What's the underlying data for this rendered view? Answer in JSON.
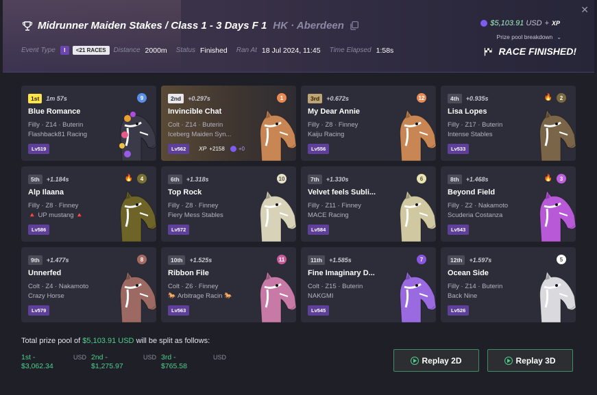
{
  "header": {
    "race_title": "Midrunner Maiden Stakes / Class 1 - 3 Days F 1",
    "location": "HK · Aberdeen",
    "prize_amount": "$5,103.91",
    "prize_unit": "USD",
    "prize_plus": "+",
    "prize_xp": "XP",
    "breakdown_label": "Prize pool breakdown",
    "status_banner": "RACE FINISHED!",
    "meta": {
      "event_type_label": "Event Type",
      "class_badge": "I",
      "races_badge": "<21 RACES",
      "distance_label": "Distance",
      "distance": "2000m",
      "status_label": "Status",
      "status": "Finished",
      "ran_at_label": "Ran At",
      "ran_at": "18 Jul 2024, 11:45",
      "elapsed_label": "Time Elapsed",
      "elapsed": "1:58s"
    }
  },
  "results": [
    {
      "place": "1st",
      "gap": "1m 57s",
      "number": "9",
      "num_color": "#5a8ee8",
      "fire": false,
      "name": "Blue Romance",
      "info": "Filly · Z14 · Buterin",
      "stable": "Flashback81 Racing",
      "level": "Lv519",
      "horse_color": "#3a3a48",
      "accent": "flowers"
    },
    {
      "place": "2nd",
      "gap": "+0.297s",
      "number": "1",
      "num_color": "#e88a55",
      "fire": false,
      "name": "Invincible Chat",
      "info": "Colt · Z14 · Buterin",
      "stable": "Iceberg Maiden Syn...",
      "level": "Lv562",
      "xp_label": "XP",
      "xp_value": "+2158",
      "xp_zero": "+0",
      "horse_color": "#c88654"
    },
    {
      "place": "3rd",
      "gap": "+0.672s",
      "number": "12",
      "num_color": "#e88a55",
      "fire": false,
      "name": "My Dear Annie",
      "info": "Filly · Z8 · Finney",
      "stable": "Kaiju Racing",
      "level": "Lv556",
      "horse_color": "#c88654"
    },
    {
      "place": "4th",
      "gap": "+0.935s",
      "number": "2",
      "num_color": "#7a6a40",
      "fire": true,
      "fire_icon": "🔥",
      "name": "Lisa Lopes",
      "info": "Filly · Z17 · Buterin",
      "stable": "Intense Stables",
      "level": "Lv533",
      "horse_color": "#7a6548"
    },
    {
      "place": "5th",
      "gap": "+1.184s",
      "number": "4",
      "num_color": "#7a7030",
      "fire": true,
      "fire_icon": "🔥",
      "name": "Alp Ilaana",
      "info": "Filly · Z8 · Finney",
      "stable": "🔺 UP mustang 🔺",
      "level": "Lv586",
      "horse_color": "#6e6428"
    },
    {
      "place": "6th",
      "gap": "+1.318s",
      "number": "10",
      "num_color": "#e8e2c8",
      "fire": false,
      "name": "Top Rock",
      "info": "Filly · Z8 · Finney",
      "stable": "Fiery Mess Stables",
      "level": "Lv572",
      "horse_color": "#d8d2b8"
    },
    {
      "place": "7th",
      "gap": "+1.330s",
      "number": "6",
      "num_color": "#ebe4b0",
      "fire": false,
      "name": "Velvet feels Subli...",
      "info": "Filly · Z11 · Finney",
      "stable": "MACE Racing",
      "level": "Lv584",
      "horse_color": "#cfc8a0"
    },
    {
      "place": "8th",
      "gap": "+1.468s",
      "number": "3",
      "num_color": "#c060e0",
      "fire": true,
      "fire_icon": "🔥",
      "name": "Beyond Field",
      "info": "Filly · Z2 · Nakamoto",
      "stable": "Scuderia Costanza",
      "level": "Lv543",
      "horse_color": "#b85ad8"
    },
    {
      "place": "9th",
      "gap": "+1.477s",
      "number": "8",
      "num_color": "#a66a60",
      "fire": false,
      "name": "Unnerfed",
      "info": "Colt · Z4 · Nakamoto",
      "stable": "Crazy Horse",
      "level": "Lv579",
      "horse_color": "#9c6a62"
    },
    {
      "place": "10th",
      "gap": "+1.525s",
      "number": "11",
      "num_color": "#c65a9a",
      "fire": false,
      "name": "Ribbon File",
      "info": "Colt · Z6 · Finney",
      "stable": "🐎 Arbitrage Racin 🐎",
      "level": "Lv563",
      "horse_color": "#c77aa6"
    },
    {
      "place": "11th",
      "gap": "+1.585s",
      "number": "7",
      "num_color": "#8a55e0",
      "fire": false,
      "name": "Fine Imaginary D...",
      "info": "Colt · Z15 · Buterin",
      "stable": "NAKGMI",
      "level": "Lv545",
      "horse_color": "#9a6ae0"
    },
    {
      "place": "12th",
      "gap": "+1.597s",
      "number": "5",
      "num_color": "#ffffff",
      "fire": false,
      "name": "Ocean Side",
      "info": "Filly · Z14 · Buterin",
      "stable": "Back Nine",
      "level": "Lv526",
      "horse_color": "#d9d9de"
    }
  ],
  "footer": {
    "pool_prefix": "Total prize pool of",
    "pool_amount": "$5,103.91 USD",
    "pool_suffix": "will be split as follows:",
    "splits": [
      {
        "place": "1st -",
        "amount": "$3,062.34",
        "unit": "USD"
      },
      {
        "place": "2nd -",
        "amount": "$1,275.97",
        "unit": "USD"
      },
      {
        "place": "3rd -",
        "amount": "$765.58",
        "unit": "USD"
      }
    ],
    "replay_2d": "Replay 2D",
    "replay_3d": "Replay 3D"
  },
  "colors": {
    "accent": "#4fcf8d",
    "level_badge": "#5e3f9a",
    "gold": "#ffe44a"
  }
}
